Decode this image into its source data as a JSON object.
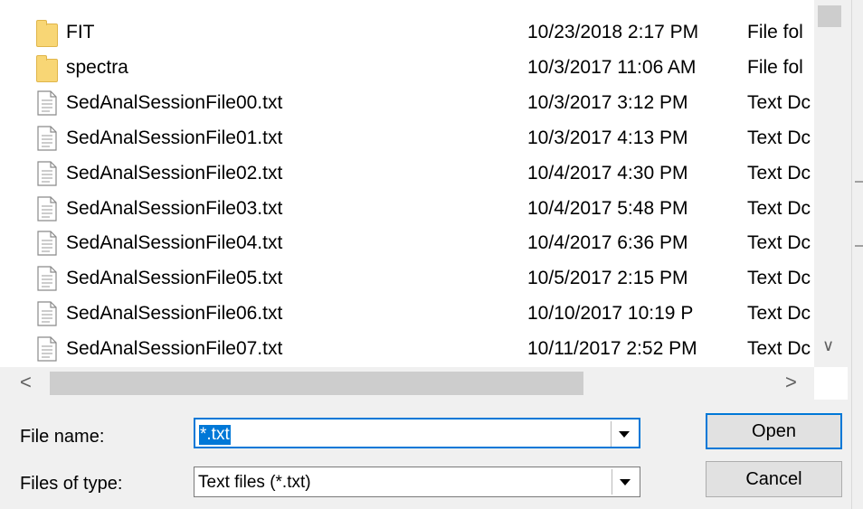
{
  "file_list": {
    "rows": [
      {
        "name": "FIT",
        "date": "10/23/2018 2:17 PM",
        "type": "File fol",
        "icon": "folder-icon"
      },
      {
        "name": "spectra",
        "date": "10/3/2017 11:06 AM",
        "type": "File fol",
        "icon": "folder-icon"
      },
      {
        "name": "SedAnalSessionFile00.txt",
        "date": "10/3/2017 3:12 PM",
        "type": "Text Dc",
        "icon": "text-file-icon"
      },
      {
        "name": "SedAnalSessionFile01.txt",
        "date": "10/3/2017 4:13 PM",
        "type": "Text Dc",
        "icon": "text-file-icon"
      },
      {
        "name": "SedAnalSessionFile02.txt",
        "date": "10/4/2017 4:30 PM",
        "type": "Text Dc",
        "icon": "text-file-icon"
      },
      {
        "name": "SedAnalSessionFile03.txt",
        "date": "10/4/2017 5:48 PM",
        "type": "Text Dc",
        "icon": "text-file-icon"
      },
      {
        "name": "SedAnalSessionFile04.txt",
        "date": "10/4/2017 6:36 PM",
        "type": "Text Dc",
        "icon": "text-file-icon"
      },
      {
        "name": "SedAnalSessionFile05.txt",
        "date": "10/5/2017 2:15 PM",
        "type": "Text Dc",
        "icon": "text-file-icon"
      },
      {
        "name": "SedAnalSessionFile06.txt",
        "date": "10/10/2017 10:19 P",
        "type": "Text Dc",
        "icon": "text-file-icon"
      },
      {
        "name": "SedAnalSessionFile07.txt",
        "date": "10/11/2017 2:52 PM",
        "type": "Text Dc",
        "icon": "text-file-icon"
      }
    ]
  },
  "scrollbars": {
    "vertical_down": "∨",
    "horizontal_left": "<",
    "horizontal_right": ">"
  },
  "form": {
    "file_name_label": "File name:",
    "file_name_value": "*.txt",
    "file_type_label": "Files of type:",
    "file_type_value": "Text files (*.txt)"
  },
  "buttons": {
    "open": "Open",
    "cancel": "Cancel"
  },
  "colors": {
    "accent": "#0078d7",
    "folder": "#f8d675"
  }
}
